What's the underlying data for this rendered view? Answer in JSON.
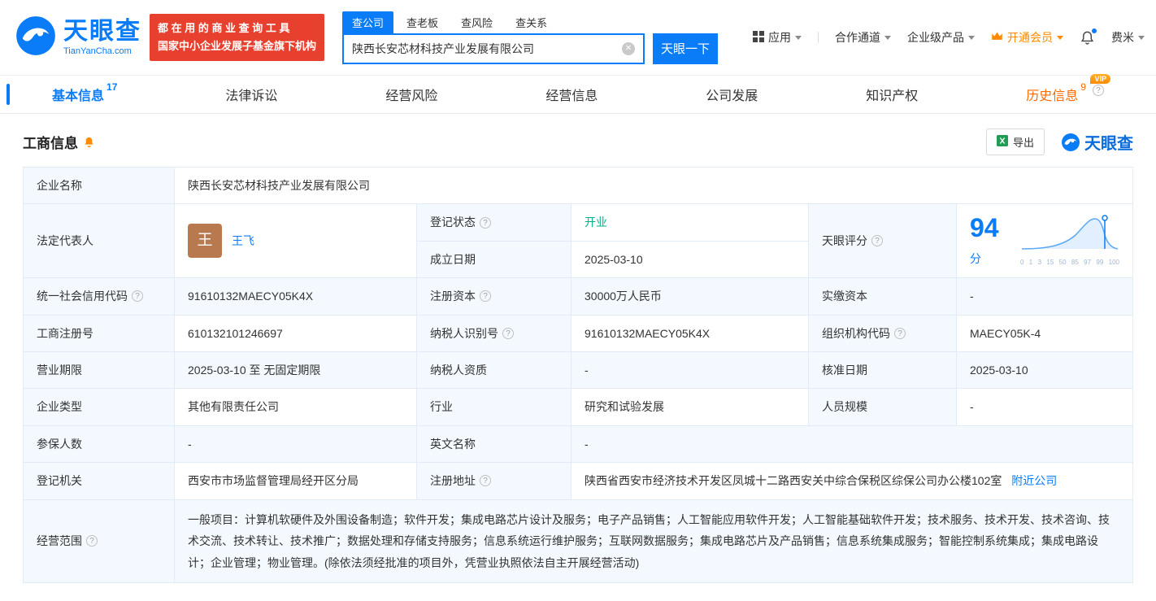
{
  "header": {
    "logo_title": "天眼查",
    "logo_subtitle": "TianYanCha.com",
    "slogan_line1": "都 在 用 的 商 业 查 询 工 具",
    "slogan_line2": "国家中小企业发展子基金旗下机构",
    "search_tabs": [
      {
        "label": "查公司"
      },
      {
        "label": "查老板"
      },
      {
        "label": "查风险"
      },
      {
        "label": "查关系"
      }
    ],
    "search_value": "陕西长安芯材科技产业发展有限公司",
    "search_button": "天眼一下",
    "nav_app": "应用",
    "nav_partner": "合作通道",
    "nav_enterprise": "企业级产品",
    "nav_vip": "开通会员",
    "nav_user": "费米"
  },
  "tabs": [
    {
      "label": "基本信息",
      "count": "17"
    },
    {
      "label": "法律诉讼"
    },
    {
      "label": "经营风险"
    },
    {
      "label": "经营信息"
    },
    {
      "label": "公司发展"
    },
    {
      "label": "知识产权"
    },
    {
      "label": "历史信息",
      "count": "9",
      "vip": "VIP"
    }
  ],
  "section": {
    "title": "工商信息",
    "export_label": "导出",
    "brand": "天眼查"
  },
  "table": {
    "name_label": "企业名称",
    "name": "陕西长安芯材科技产业发展有限公司",
    "legal_rep_label": "法定代表人",
    "legal_rep_avatar": "王",
    "legal_rep": "王飞",
    "reg_status_label": "登记状态",
    "reg_status": "开业",
    "establish_date_label": "成立日期",
    "establish_date": "2025-03-10",
    "score_label": "天眼评分",
    "credit_code_label": "统一社会信用代码",
    "credit_code": "91610132MAECY05K4X",
    "reg_capital_label": "注册资本",
    "reg_capital": "30000万人民币",
    "paid_capital_label": "实缴资本",
    "paid_capital": "-",
    "reg_number_label": "工商注册号",
    "reg_number": "610132101246697",
    "taxpayer_id_label": "纳税人识别号",
    "taxpayer_id": "91610132MAECY05K4X",
    "org_code_label": "组织机构代码",
    "org_code": "MAECY05K-4",
    "business_term_label": "营业期限",
    "business_term": "2025-03-10 至 无固定期限",
    "taxpayer_quality_label": "纳税人资质",
    "taxpayer_quality": "-",
    "approval_date_label": "核准日期",
    "approval_date": "2025-03-10",
    "company_type_label": "企业类型",
    "company_type": "其他有限责任公司",
    "industry_label": "行业",
    "industry": "研究和试验发展",
    "staff_size_label": "人员规模",
    "staff_size": "-",
    "insured_label": "参保人数",
    "insured": "-",
    "english_name_label": "英文名称",
    "english_name": "-",
    "reg_authority_label": "登记机关",
    "reg_authority": "西安市市场监督管理局经开区分局",
    "address_label": "注册地址",
    "address": "陕西省西安市经济技术开发区凤城十二路西安关中综合保税区综保公司办公楼102室",
    "address_link": "附近公司",
    "business_scope_label": "经营范围",
    "business_scope": "一般项目：计算机软硬件及外围设备制造；软件开发；集成电路芯片设计及服务；电子产品销售；人工智能应用软件开发；人工智能基础软件开发；技术服务、技术开发、技术咨询、技术交流、技术转让、技术推广；数据处理和存储支持服务；信息系统运行维护服务；互联网数据服务；集成电路芯片及产品销售；信息系统集成服务；智能控制系统集成；集成电路设计；企业管理；物业管理。(除依法须经批准的项目外，凭营业执照依法自主开展经营活动)"
  },
  "score": {
    "value": "94",
    "unit": "分",
    "axis": [
      "0",
      "1",
      "3",
      "15",
      "50",
      "85",
      "97",
      "99",
      "100"
    ]
  }
}
